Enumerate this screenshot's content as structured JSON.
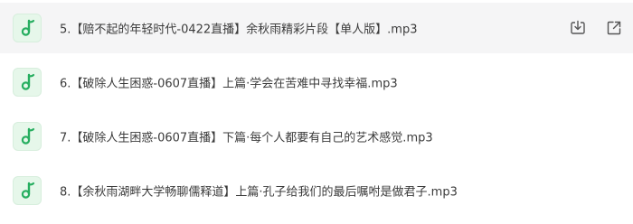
{
  "colors": {
    "icon_green": "#27ae60",
    "icon_bg": "#e6f7ea",
    "hover_bg": "#f5f5f6",
    "text": "#3b3b3b",
    "action_icon": "#555555"
  },
  "files": [
    {
      "name": "5.【赔不起的年轻时代-0422直播】余秋雨精彩片段【单人版】.mp3",
      "icon": "music-note-icon",
      "hovered": true
    },
    {
      "name": "6.【破除人生困惑-0607直播】上篇·学会在苦难中寻找幸福.mp3",
      "icon": "music-note-icon",
      "hovered": false
    },
    {
      "name": "7.【破除人生困惑-0607直播】下篇·每个人都要有自己的艺术感觉.mp3",
      "icon": "music-note-icon",
      "hovered": false
    },
    {
      "name": "8.【余秋雨湖畔大学畅聊儒释道】上篇·孔子给我们的最后嘱咐是做君子.mp3",
      "icon": "music-note-icon",
      "hovered": false
    }
  ],
  "row_actions": [
    {
      "icon": "download-icon"
    },
    {
      "icon": "open-external-icon"
    }
  ]
}
